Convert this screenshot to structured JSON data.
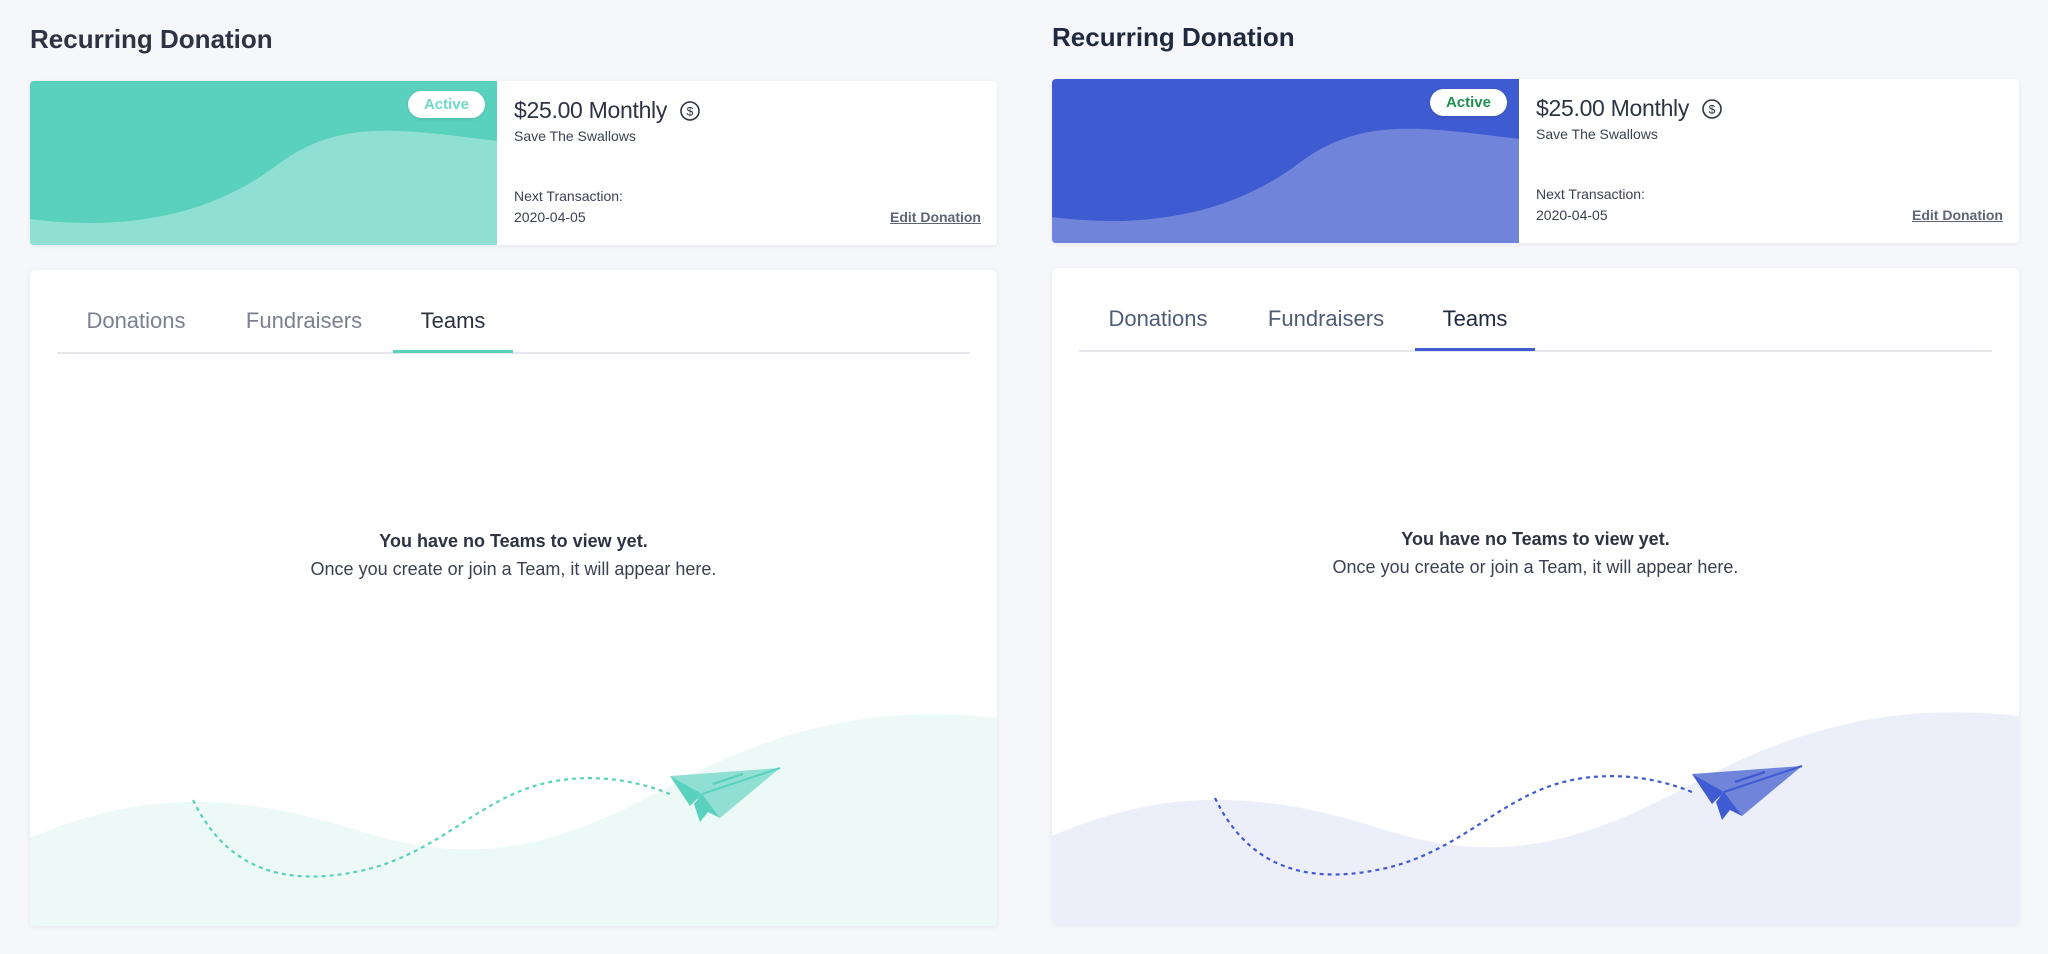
{
  "panels": [
    {
      "theme": "teal",
      "page_title": "Recurring Donation",
      "summary": {
        "status": "Active",
        "amount": "$25.00 Monthly",
        "cause": "Save The Swallows",
        "next_label": "Next Transaction:",
        "next_date": "2020-04-05",
        "edit_label": "Edit Donation"
      },
      "tabs": [
        {
          "label": "Donations",
          "active": false
        },
        {
          "label": "Fundraisers",
          "active": false
        },
        {
          "label": "Teams",
          "active": true
        }
      ],
      "empty_state": {
        "title": "You have no Teams to view yet.",
        "subtitle": "Once you create or join a Team, it will appear here."
      },
      "colors": {
        "accent": "#5ad1bd",
        "accent_light": "#8fe0d2",
        "badge_text": "#6fd8c6",
        "tab_inactive": "#7b8090",
        "tab_active": "#2d3343",
        "wave_bg": "#edf9f6"
      },
      "icons": {
        "currency": "dollar-circle-icon",
        "illustration": "paper-plane-icon"
      }
    },
    {
      "theme": "blue",
      "page_title": "Recurring Donation",
      "summary": {
        "status": "Active",
        "amount": "$25.00 Monthly",
        "cause": "Save The Swallows",
        "next_label": "Next Transaction:",
        "next_date": "2020-04-05",
        "edit_label": "Edit Donation"
      },
      "tabs": [
        {
          "label": "Donations",
          "active": false
        },
        {
          "label": "Fundraisers",
          "active": false
        },
        {
          "label": "Teams",
          "active": true
        }
      ],
      "empty_state": {
        "title": "You have no Teams to view yet.",
        "subtitle": "Once you create or join a Team, it will appear here."
      },
      "colors": {
        "accent": "#3f5bd1",
        "accent_light": "#7085da",
        "badge_text": "#1f8f4f",
        "tab_inactive": "#4f5c78",
        "tab_active": "#1f2940",
        "wave_bg": "#eceef9"
      },
      "icons": {
        "currency": "dollar-circle-icon",
        "illustration": "paper-plane-icon"
      }
    }
  ]
}
